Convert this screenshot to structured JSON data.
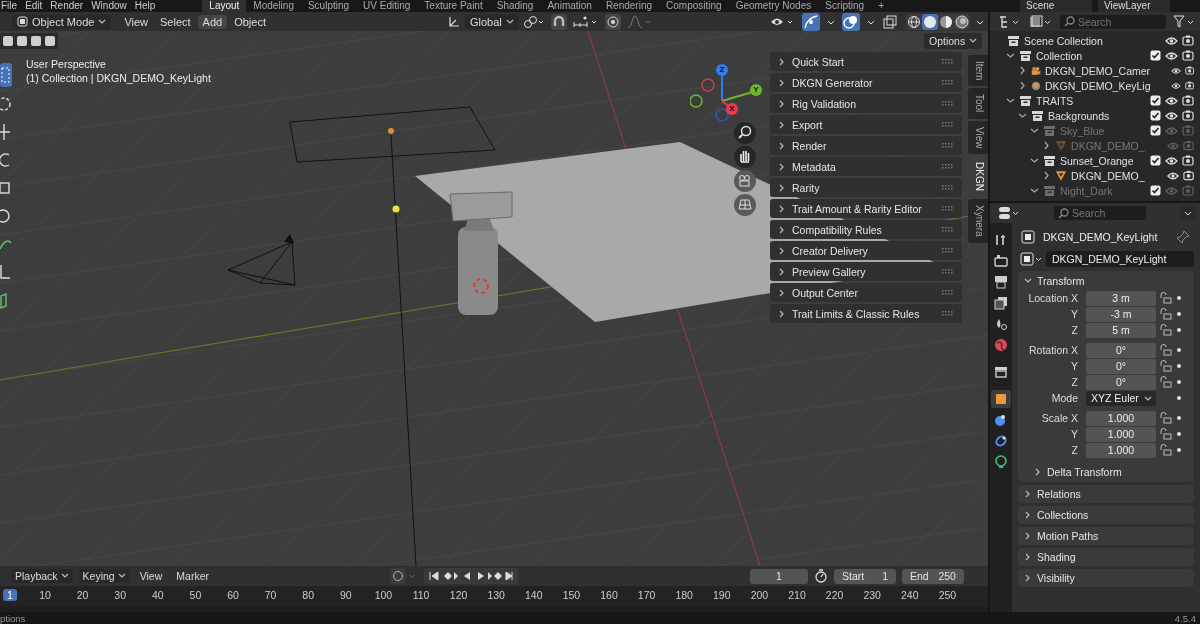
{
  "top_bar": {
    "menus": [
      "File",
      "Edit",
      "Render",
      "Window",
      "Help"
    ],
    "workspaces": [
      {
        "label": "Layout",
        "selected": true
      },
      {
        "label": "Modeling",
        "selected": false
      },
      {
        "label": "Sculpting",
        "selected": false
      },
      {
        "label": "UV Editing",
        "selected": false
      },
      {
        "label": "Texture Paint",
        "selected": false
      },
      {
        "label": "Shading",
        "selected": false
      },
      {
        "label": "Animation",
        "selected": false
      },
      {
        "label": "Rendering",
        "selected": false
      },
      {
        "label": "Compositing",
        "selected": false
      },
      {
        "label": "Geometry Nodes",
        "selected": false
      },
      {
        "label": "Scripting",
        "selected": false
      }
    ],
    "add_tab": "+",
    "scene": "Scene",
    "view_layer": "ViewLayer"
  },
  "viewport_header": {
    "mode": "Object Mode",
    "menus": [
      {
        "label": "View",
        "selected": false
      },
      {
        "label": "Select",
        "selected": false
      },
      {
        "label": "Add",
        "selected": true
      },
      {
        "label": "Object",
        "selected": false
      }
    ],
    "orientation": "Global",
    "shading_modes": [
      {
        "kind": "wireframe",
        "selected": false
      },
      {
        "kind": "solid",
        "selected": true
      },
      {
        "kind": "material",
        "selected": false
      },
      {
        "kind": "rendered",
        "selected": false
      }
    ]
  },
  "viewport": {
    "view_name": "User Perspective",
    "context": "(1) Collection | DKGN_DEMO_KeyLight",
    "options": "Options",
    "gizmo_axes": [
      {
        "label": "Z",
        "color": "#2f7cf0"
      },
      {
        "label": "Y",
        "color": "#71b52c"
      },
      {
        "label": "X",
        "color": "#f0364f"
      }
    ]
  },
  "sidebar": {
    "panels": [
      {
        "label": "Quick Start",
        "expanded": false
      },
      {
        "label": "DKGN Generator",
        "expanded": false
      },
      {
        "label": "Rig Validation",
        "expanded": false
      },
      {
        "label": "Export",
        "expanded": false
      },
      {
        "label": "Render",
        "expanded": false
      },
      {
        "label": "Metadata",
        "expanded": false
      },
      {
        "label": "Rarity",
        "expanded": false
      },
      {
        "label": "Trait Amount & Rarity Editor",
        "expanded": false
      },
      {
        "label": "Compatibility Rules",
        "expanded": false
      },
      {
        "label": "Creator Delivery",
        "expanded": false
      },
      {
        "label": "Preview Gallery",
        "expanded": false
      },
      {
        "label": "Output Center",
        "expanded": false
      },
      {
        "label": "Trait Limits & Classic Rules",
        "expanded": false
      }
    ],
    "tabs": [
      {
        "label": "Item",
        "selected": false
      },
      {
        "label": "Tool",
        "selected": false
      },
      {
        "label": "View",
        "selected": false
      },
      {
        "label": "DKGN",
        "selected": true
      },
      {
        "label": "Xynera",
        "selected": false
      }
    ]
  },
  "outliner": {
    "search": {
      "placeholder": "Search"
    },
    "tree": [
      {
        "label": "Scene Collection",
        "kind": "scene",
        "children": [
          {
            "label": "Collection",
            "kind": "collection",
            "expanded": true,
            "checked": true,
            "dimmed": false,
            "children": [
              {
                "label": "DKGN_DEMO_Camer",
                "kind": "camera",
                "expanded": false,
                "dimmed": false
              },
              {
                "label": "DKGN_DEMO_KeyLig",
                "kind": "light",
                "expanded": false,
                "dimmed": false
              }
            ]
          },
          {
            "label": "TRAITS",
            "kind": "collection",
            "expanded": true,
            "checked": true,
            "dimmed": false,
            "children": [
              {
                "label": "Backgrounds",
                "kind": "collection",
                "expanded": true,
                "checked": true,
                "dimmed": false,
                "children": [
                  {
                    "label": "Sky_Blue",
                    "kind": "collection",
                    "expanded": true,
                    "checked": true,
                    "dimmed": true,
                    "children": [
                      {
                        "label": "DKGN_DEMO_",
                        "kind": "mesh",
                        "expanded": false,
                        "dimmed": true
                      }
                    ]
                  },
                  {
                    "label": "Sunset_Orange",
                    "kind": "collection",
                    "expanded": true,
                    "checked": true,
                    "dimmed": false,
                    "children": [
                      {
                        "label": "DKGN_DEMO_",
                        "kind": "mesh",
                        "expanded": false,
                        "dimmed": false
                      }
                    ]
                  },
                  {
                    "label": "Night_Dark",
                    "kind": "collection",
                    "expanded": true,
                    "checked": true,
                    "dimmed": true
                  }
                ]
              }
            ]
          }
        ]
      }
    ]
  },
  "properties": {
    "search": {
      "placeholder": "Search"
    },
    "tabs": [
      {
        "kind": "tool",
        "selected": false
      },
      {
        "kind": "render",
        "selected": false
      },
      {
        "kind": "output",
        "selected": false
      },
      {
        "kind": "view_layer",
        "selected": false
      },
      {
        "kind": "scene",
        "selected": false
      },
      {
        "kind": "world",
        "selected": false
      },
      {
        "kind": "collection",
        "selected": false
      },
      {
        "kind": "object",
        "selected": true
      },
      {
        "kind": "physics",
        "selected": false
      },
      {
        "kind": "constraints",
        "selected": false
      },
      {
        "kind": "data",
        "selected": false
      }
    ],
    "object_name": "DKGN_DEMO_KeyLight",
    "data_name": "DKGN_DEMO_KeyLight",
    "transform": {
      "label": "Transform",
      "expanded": true,
      "groups": [
        {
          "rows": [
            {
              "label": "Location X",
              "value": "3 m",
              "kind": "number"
            },
            {
              "label": "Y",
              "value": "-3 m",
              "kind": "number"
            },
            {
              "label": "Z",
              "value": "5 m",
              "kind": "number"
            }
          ]
        },
        {
          "rows": [
            {
              "label": "Rotation X",
              "value": "0°",
              "kind": "number"
            },
            {
              "label": "Y",
              "value": "0°",
              "kind": "number"
            },
            {
              "label": "Z",
              "value": "0°",
              "kind": "number"
            },
            {
              "label": "Mode",
              "value": "XYZ Euler",
              "kind": "dropdown"
            }
          ]
        },
        {
          "rows": [
            {
              "label": "Scale X",
              "value": "1.000",
              "kind": "number"
            },
            {
              "label": "Y",
              "value": "1.000",
              "kind": "number"
            },
            {
              "label": "Z",
              "value": "1.000",
              "kind": "number"
            }
          ]
        }
      ],
      "subpanel": {
        "label": "Delta Transform",
        "expanded": false
      }
    },
    "panels": [
      {
        "label": "Relations",
        "expanded": false
      },
      {
        "label": "Collections",
        "expanded": false
      },
      {
        "label": "Motion Paths",
        "expanded": false
      },
      {
        "label": "Shading",
        "expanded": false
      },
      {
        "label": "Visibility",
        "expanded": false
      }
    ]
  },
  "timeline": {
    "menus": [
      {
        "label": "Playback",
        "kind": "dropdown"
      },
      {
        "label": "Keying",
        "kind": "dropdown"
      },
      {
        "label": "View",
        "kind": "menu"
      },
      {
        "label": "Marker",
        "kind": "menu"
      }
    ],
    "current_frame": "1",
    "start": {
      "label": "Start",
      "value": "1"
    },
    "end": {
      "label": "End",
      "value": "250"
    },
    "ruler": [
      {
        "label": "1",
        "selected": true
      },
      {
        "label": "10",
        "selected": false
      },
      {
        "label": "20",
        "selected": false
      },
      {
        "label": "30",
        "selected": false
      },
      {
        "label": "40",
        "selected": false
      },
      {
        "label": "50",
        "selected": false
      },
      {
        "label": "60",
        "selected": false
      },
      {
        "label": "70",
        "selected": false
      },
      {
        "label": "80",
        "selected": false
      },
      {
        "label": "90",
        "selected": false
      },
      {
        "label": "100",
        "selected": false
      },
      {
        "label": "110",
        "selected": false
      },
      {
        "label": "120",
        "selected": false
      },
      {
        "label": "130",
        "selected": false
      },
      {
        "label": "140",
        "selected": false
      },
      {
        "label": "150",
        "selected": false
      },
      {
        "label": "160",
        "selected": false
      },
      {
        "label": "170",
        "selected": false
      },
      {
        "label": "180",
        "selected": false
      },
      {
        "label": "190",
        "selected": false
      },
      {
        "label": "200",
        "selected": false
      },
      {
        "label": "210",
        "selected": false
      },
      {
        "label": "220",
        "selected": false
      },
      {
        "label": "230",
        "selected": false
      },
      {
        "label": "240",
        "selected": false
      },
      {
        "label": "250",
        "selected": false
      }
    ]
  },
  "status_bar": {
    "hint": "ptions",
    "version": "4.5.4"
  }
}
